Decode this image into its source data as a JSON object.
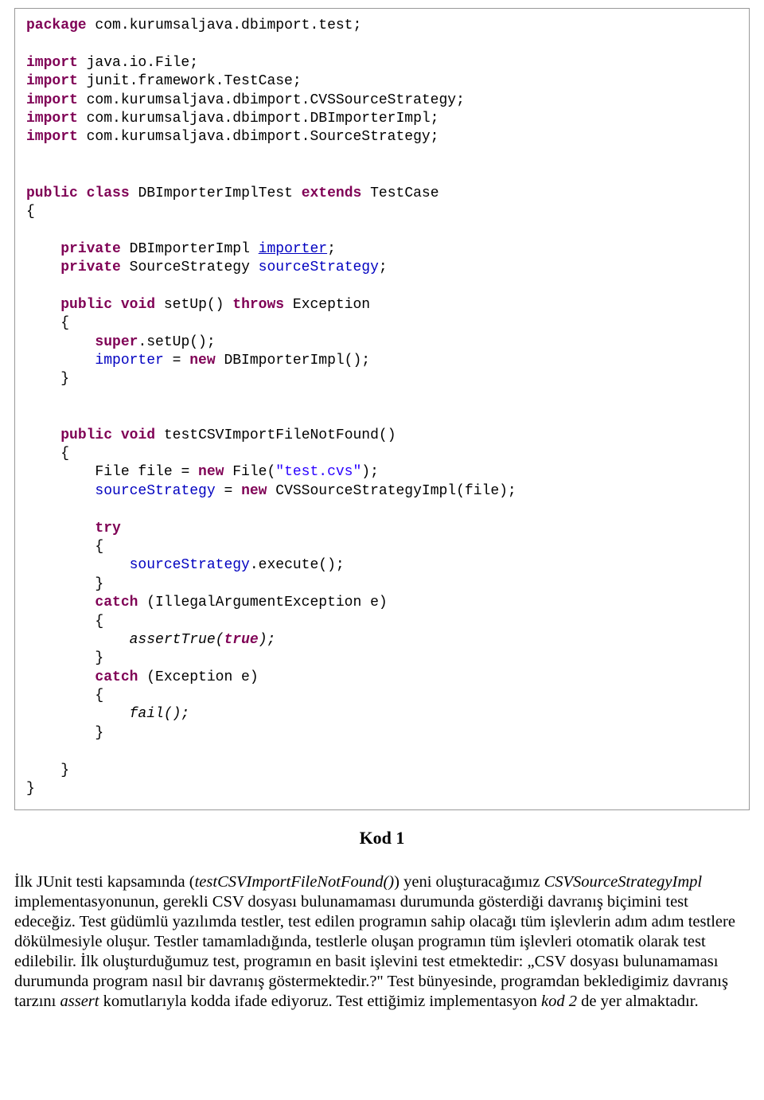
{
  "code": {
    "package_kw": "package",
    "package_name": " com.kurumsaljava.dbimport.test;",
    "import_kw": "import",
    "imports": [
      " java.io.File;",
      " junit.framework.TestCase;",
      " com.kurumsaljava.dbimport.CVSSourceStrategy;",
      " com.kurumsaljava.dbimport.DBImporterImpl;",
      " com.kurumsaljava.dbimport.SourceStrategy;"
    ],
    "public_kw": "public",
    "class_kw": "class",
    "extends_kw": "extends",
    "class_name": " DBImporterImplTest ",
    "super_type": " TestCase",
    "private_kw": "private",
    "field1_type": " DBImporterImpl ",
    "field1_name": "importer",
    "field2_type": " SourceStrategy ",
    "field2_name": "sourceStrategy",
    "void_kw": "void",
    "setup_sig": " setUp() ",
    "throws_kw": "throws",
    "exception_type": " Exception",
    "super_kw": "super",
    "super_call": ".setUp();",
    "importer_assign_pre": " = ",
    "new_kw": "new",
    "importer_ctor": " DBImporterImpl();",
    "test_method_sig": " testCSVImportFileNotFound()",
    "file_decl_pre": "File file = ",
    "file_ctor": " File(",
    "file_arg": "\"test.cvs\"",
    "file_close": ");",
    "strategy_assign_pre": " = ",
    "strategy_ctor": " CVSSourceStrategyImpl(file);",
    "try_kw": "try",
    "exec_call": ".execute();",
    "catch_kw": "catch",
    "catch1_sig": " (IllegalArgumentException e)",
    "assert_call": "assertTrue",
    "true_kw": "true",
    "catch2_sig": " (Exception e)",
    "fail_call": "fail();"
  },
  "caption": "Kod 1",
  "para": {
    "t1": "İlk JUnit testi kapsamında (",
    "i1": "testCSVImportFileNotFound()",
    "t2": ") yeni oluşturacağımız ",
    "i2": "CSVSourceStrategyImpl",
    "t3": " implementasyonunun, gerekli CSV dosyası bulunamaması durumunda gösterdiği davranış biçimini test edeceğiz. Test güdümlü yazılımda testler, test edilen programın sahip olacağı tüm işlevlerin adım adım testlere dökülmesiyle oluşur. Testler tamamladığında, testlerle oluşan programın tüm işlevleri otomatik olarak test edilebilir. İlk oluşturduğumuz test, programın en basit işlevini test etmektedir: „CSV dosyası bulunamaması durumunda program nasıl bir davranış göstermektedir.?\" Test bünyesinde,  programdan bekledigimiz davranış tarzını ",
    "i3": "assert",
    "t4": " komutlarıyla kodda ifade ediyoruz. Test ettiğimiz implementasyon ",
    "i4": "kod 2",
    "t5": " de yer almaktadır."
  }
}
